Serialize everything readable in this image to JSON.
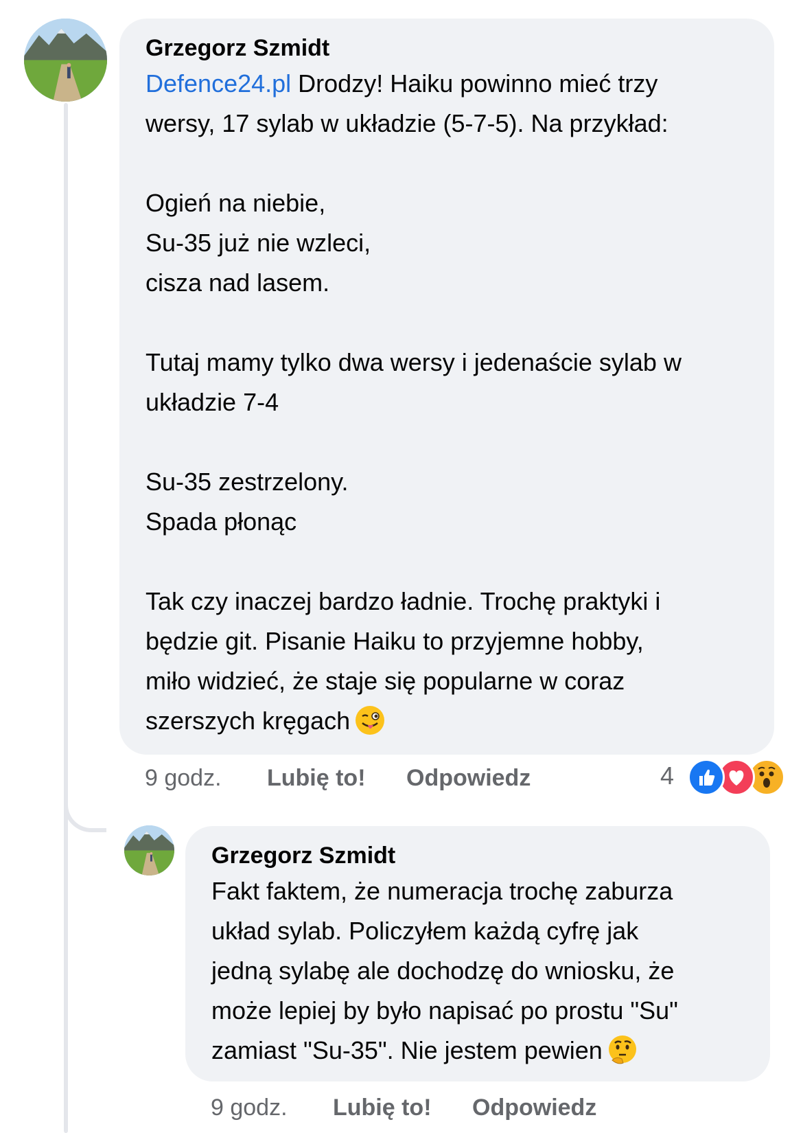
{
  "comments": [
    {
      "author": "Grzegorz Szmidt",
      "mention": "Defence24.pl",
      "paragraphs": [
        "Drodzy! Haiku powinno mieć trzy\nwersy, 17 sylab w układzie (5-7-5). Na przykład:",
        "Ogień na niebie,\nSu-35 już nie wzleci,\ncisza nad lasem.",
        "Tutaj mamy tylko dwa wersy i jedenaście sylab w\nukładzie 7-4",
        "Su-35 zestrzelony.\nSpada płonąc",
        "Tak czy inaczej bardzo ładnie. Trochę praktyki i\nbędzie git. Pisanie Haiku to przyjemne hobby,\nmiło widzieć, że staje się popularne w coraz\nszerszych kręgach"
      ],
      "emoji": "winking-face-with-tongue",
      "time": "9 godz.",
      "like_label": "Lubię to!",
      "reply_label": "Odpowiedz",
      "reactions": {
        "count": "4",
        "types": [
          "like",
          "love",
          "wow"
        ],
        "colors": {
          "like": "#1877f2",
          "love": "#f33e58",
          "wow": "#f7b125"
        }
      }
    },
    {
      "author": "Grzegorz Szmidt",
      "text": "Fakt faktem, że numeracja trochę zaburza\nukład sylab. Policzyłem każdą cyfrę jak\njedną sylabę ale dochodzę do wniosku, że\nmoże lepiej by było napisać po prostu \"Su\"\nzamiast \"Su-35\". Nie jestem pewien",
      "emoji": "thinking-face",
      "time": "9 godz.",
      "like_label": "Lubię to!",
      "reply_label": "Odpowiedz"
    }
  ],
  "colors": {
    "bubble": "#f0f2f5",
    "mention": "#216fdb",
    "meta_text": "#65676b",
    "thread_line": "#e4e6eb"
  }
}
